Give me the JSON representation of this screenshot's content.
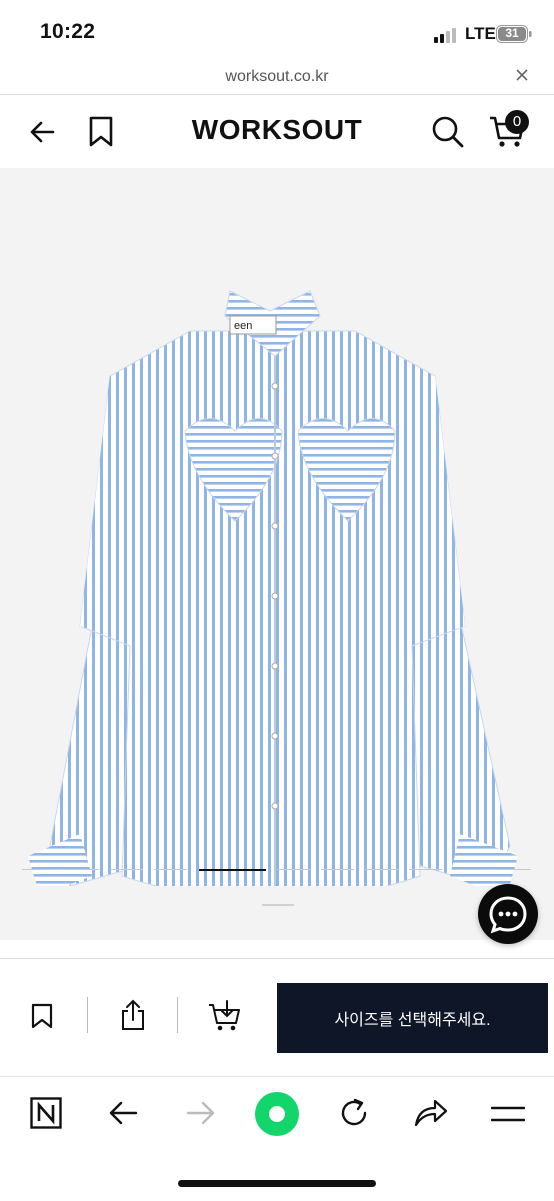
{
  "status_bar": {
    "time": "10:22",
    "network": "LTE",
    "battery": "31"
  },
  "url_bar": {
    "domain": "worksout.co.kr",
    "close_icon": "close-icon"
  },
  "header": {
    "brand": "WORKSOUT",
    "cart_count": "0",
    "icons": [
      "back-arrow-icon",
      "bookmark-icon",
      "search-icon",
      "cart-icon"
    ]
  },
  "gallery": {
    "image_description_icon": "striped-shirt-image",
    "total_slides": 11,
    "active_slide": 5,
    "shirt_label": "een"
  },
  "action_bar": {
    "size_button_label": "사이즈를 선택해주세요.",
    "icons": [
      "bookmark-icon",
      "share-icon",
      "add-to-cart-icon"
    ]
  },
  "browser_toolbar": {
    "icons": [
      "naver-home-icon",
      "back-icon",
      "forward-icon",
      "green-dot-icon",
      "reload-icon",
      "share-icon",
      "menu-icon"
    ]
  },
  "colors": {
    "accent_button": "#0e1628",
    "green_dot": "#12d66b",
    "gallery_bg": "#f3f3f3"
  }
}
